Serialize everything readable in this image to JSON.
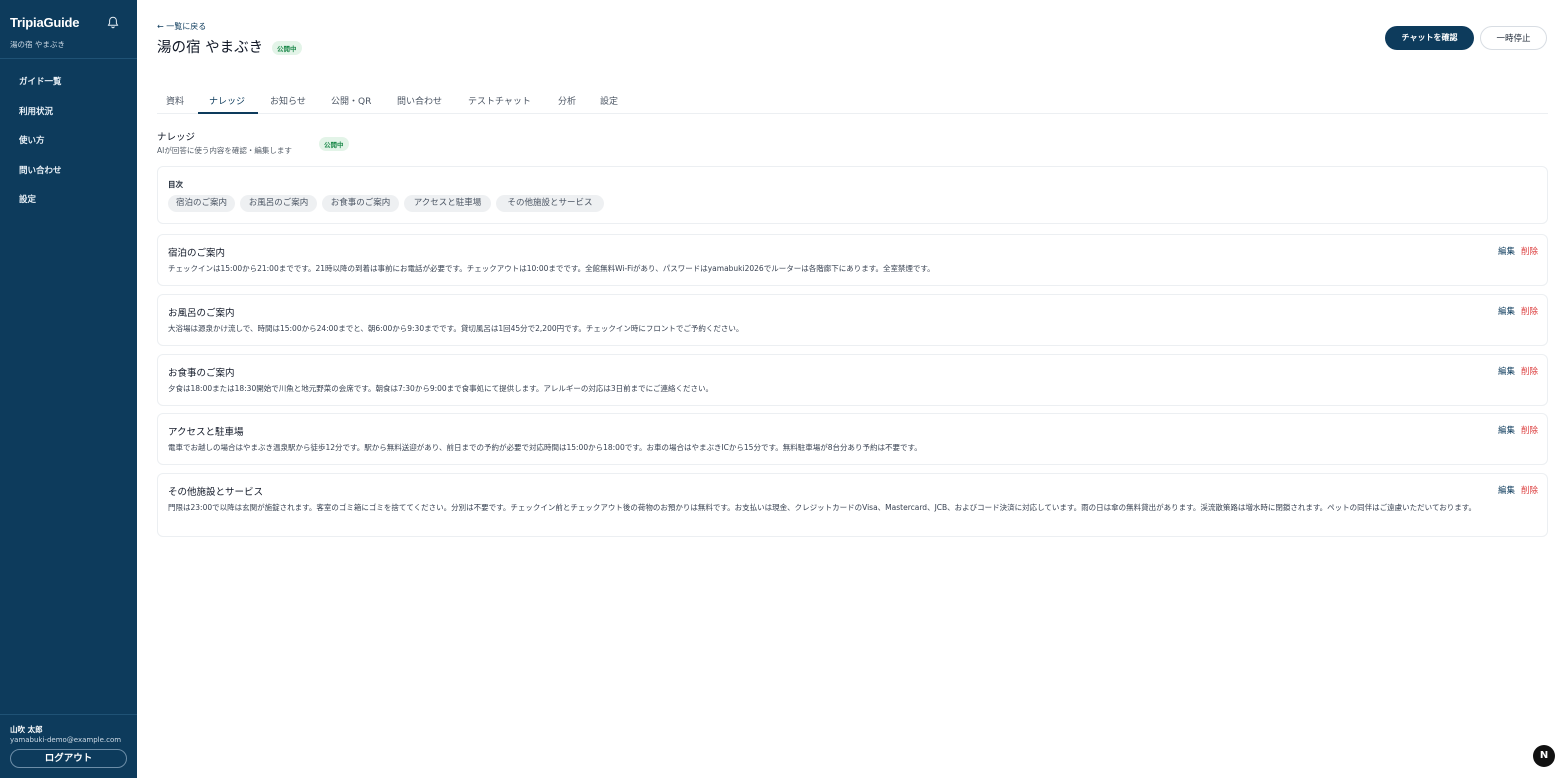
{
  "sidebar": {
    "brand": "TripiaGuide",
    "facility": "湯の宿 やまぶき",
    "nav": [
      "ガイド一覧",
      "利用状況",
      "使い方",
      "問い合わせ",
      "設定"
    ],
    "user_name": "山吹 太郎",
    "user_email": "yamabuki-demo@example.com",
    "logout": "ログアウト"
  },
  "header": {
    "back": "← 一覧に戻る",
    "title": "湯の宿 やまぶき",
    "status": "公開中",
    "primary_button": "チャットを確認",
    "secondary_button": "一時停止"
  },
  "tabs": [
    "資料",
    "ナレッジ",
    "お知らせ",
    "公開・QR",
    "問い合わせ",
    "テストチャット",
    "分析",
    "設定"
  ],
  "active_tab": "ナレッジ",
  "section": {
    "title": "ナレッジ",
    "description": "AIが回答に使う内容を確認・編集します",
    "status": "公開中"
  },
  "toc": {
    "label": "目次",
    "items": [
      "宿泊のご案内",
      "お風呂のご案内",
      "お食事のご案内",
      "アクセスと駐車場",
      "その他施設とサービス"
    ]
  },
  "actions": {
    "edit": "編集",
    "delete": "削除"
  },
  "entries": [
    {
      "title": "宿泊のご案内",
      "body": "チェックインは15:00から21:00までです。21時以降の到着は事前にお電話が必要です。チェックアウトは10:00までです。全館無料Wi-Fiがあり、パスワードはyamabuki2026でルーターは各階廊下にあります。全室禁煙です。"
    },
    {
      "title": "お風呂のご案内",
      "body": "大浴場は源泉かけ流しで、時間は15:00から24:00までと、朝6:00から9:30までです。貸切風呂は1回45分で2,200円です。チェックイン時にフロントでご予約ください。"
    },
    {
      "title": "お食事のご案内",
      "body": "夕食は18:00または18:30開始で川魚と地元野菜の会席です。朝食は7:30から9:00まで食事処にて提供します。アレルギーの対応は3日前までにご連絡ください。"
    },
    {
      "title": "アクセスと駐車場",
      "body": "電車でお越しの場合はやまぶき温泉駅から徒歩12分です。駅から無料送迎があり、前日までの予約が必要で対応時間は15:00から18:00です。お車の場合はやまぶきICから15分です。無料駐車場が8台分あり予約は不要です。"
    },
    {
      "title": "その他施設とサービス",
      "body": "門限は23:00で以降は玄関が施錠されます。客室のゴミ箱にゴミを捨ててください。分別は不要です。チェックイン前とチェックアウト後の荷物のお預かりは無料です。お支払いは現金、クレジットカードのVisa、Mastercard、JCB、およびコード決済に対応しています。雨の日は傘の無料貸出があります。渓流散策路は増水時に閉鎖されます。ペットの同伴はご遠慮いただいております。"
    }
  ],
  "fab": "N"
}
